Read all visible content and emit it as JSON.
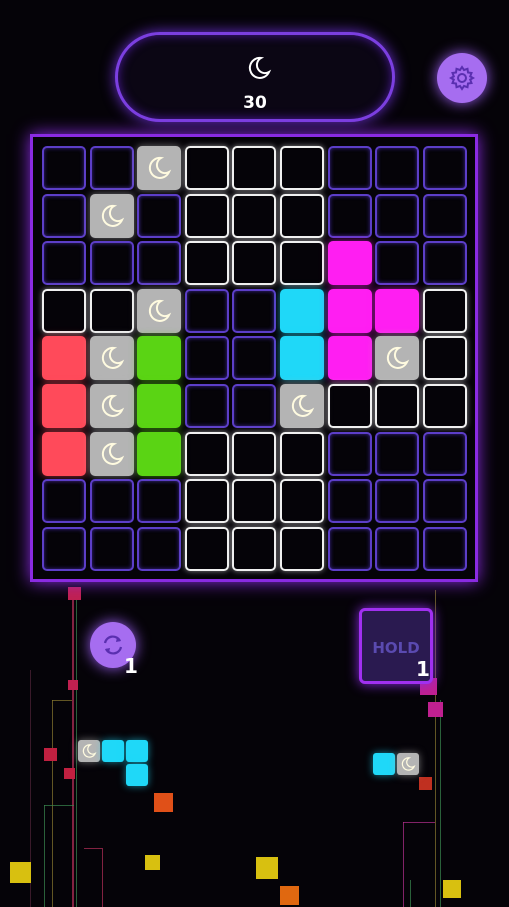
{
  "score": {
    "value": "30",
    "icon": "moon-icon"
  },
  "settings": {
    "icon": "gear-icon"
  },
  "rotate": {
    "icon": "rotate-icon",
    "count": "1"
  },
  "hold": {
    "label": "HOLD",
    "count": "1"
  },
  "colors": {
    "red": "#ff4a5a",
    "green": "#5ad414",
    "cyan": "#1fd8f8",
    "magenta": "#ff1ef2",
    "gray": "#b4b4b4",
    "purple_border": "#5c3ec8",
    "white_border": "#f0f0f0",
    "accent": "#a66df0"
  },
  "board": {
    "rows": [
      [
        "P",
        "P",
        "G",
        "W",
        "W",
        "W",
        "P",
        "P",
        "P"
      ],
      [
        "P",
        "G",
        "P",
        "W",
        "W",
        "W",
        "P",
        "P",
        "P"
      ],
      [
        "P",
        "P",
        "P",
        "W",
        "W",
        "W",
        "M",
        "P",
        "P"
      ],
      [
        "W",
        "W",
        "G",
        "P",
        "P",
        "C",
        "M",
        "M",
        "W"
      ],
      [
        "R",
        "G",
        "N",
        "P",
        "P",
        "C",
        "M",
        "G",
        "W"
      ],
      [
        "R",
        "G",
        "N",
        "P",
        "P",
        "G",
        "W",
        "W",
        "W"
      ],
      [
        "R",
        "G",
        "N",
        "W",
        "W",
        "W",
        "P",
        "P",
        "P"
      ],
      [
        "P",
        "P",
        "P",
        "W",
        "W",
        "W",
        "P",
        "P",
        "P"
      ],
      [
        "P",
        "P",
        "P",
        "W",
        "W",
        "W",
        "P",
        "P",
        "P"
      ]
    ]
  },
  "next_piece": {
    "cells": [
      "G",
      "C",
      "C",
      "",
      "",
      "C"
    ]
  },
  "hold_piece": {
    "cells": [
      "C",
      "G"
    ]
  }
}
